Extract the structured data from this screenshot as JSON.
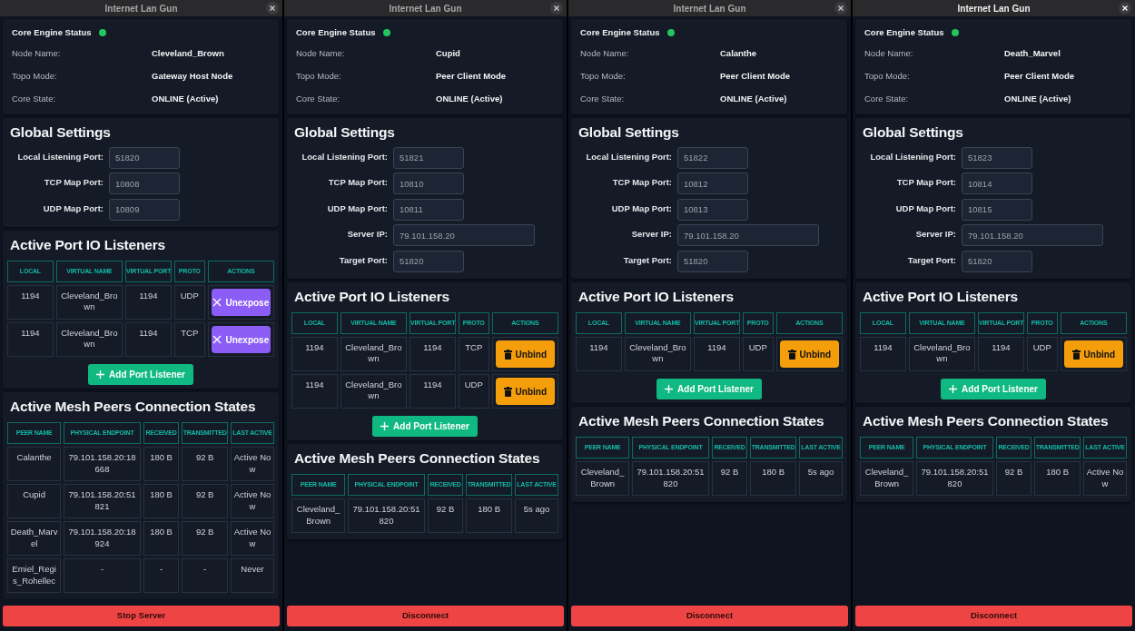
{
  "windows": [
    {
      "title": "Internet Lan Gun",
      "focused": false,
      "status": {
        "title": "Core Engine Status",
        "online": true,
        "rows": [
          {
            "label": "Node Name:",
            "value": "Cleveland_Brown"
          },
          {
            "label": "Topo Mode:",
            "value": "Gateway Host Node"
          },
          {
            "label": "Core State:",
            "value": "ONLINE (Active)"
          }
        ]
      },
      "settings": {
        "title": "Global Settings",
        "fields": [
          {
            "label": "Local Listening Port:",
            "value": "51820",
            "kind": "port"
          },
          {
            "label": "TCP Map Port:",
            "value": "10808",
            "kind": "port"
          },
          {
            "label": "UDP Map Port:",
            "value": "10809",
            "kind": "port"
          }
        ]
      },
      "listeners": {
        "title": "Active Port IO Listeners",
        "columns": [
          "LOCAL",
          "VIRTUAL NAME",
          "VIRTUAL PORT",
          "PROTO",
          "ACTIONS"
        ],
        "rows": [
          {
            "cells": [
              "1194",
              "Cleveland_Brown",
              "1194",
              "UDP"
            ],
            "action": {
              "kind": "unexpose",
              "label": "Unexpose"
            }
          },
          {
            "cells": [
              "1194",
              "Cleveland_Brown",
              "1194",
              "TCP"
            ],
            "action": {
              "kind": "unexpose",
              "label": "Unexpose"
            }
          }
        ],
        "add_button": "Add Port Listener"
      },
      "peers": {
        "title": "Active Mesh Peers Connection States",
        "columns": [
          "PEER NAME",
          "PHYSICAL ENDPOINT",
          "RECEIVED",
          "TRANSMITTED",
          "LAST ACTIVE"
        ],
        "rows": [
          [
            "Calanthe",
            "79.101.158.20:18668",
            "180 B",
            "92 B",
            "Active Now"
          ],
          [
            "Cupid",
            "79.101.158.20:51821",
            "180 B",
            "92 B",
            "Active Now"
          ],
          [
            "Death_Marvel",
            "79.101.158.20:18924",
            "180 B",
            "92 B",
            "Active Now"
          ],
          [
            "Emiel_Regis_Rohellec",
            "-",
            "-",
            "-",
            "Never"
          ]
        ]
      },
      "footer_button": "Stop Server"
    },
    {
      "title": "Internet Lan Gun",
      "focused": false,
      "status": {
        "title": "Core Engine Status",
        "online": true,
        "rows": [
          {
            "label": "Node Name:",
            "value": "Cupid"
          },
          {
            "label": "Topo Mode:",
            "value": "Peer Client Mode"
          },
          {
            "label": "Core State:",
            "value": "ONLINE (Active)"
          }
        ]
      },
      "settings": {
        "title": "Global Settings",
        "fields": [
          {
            "label": "Local Listening Port:",
            "value": "51821",
            "kind": "port"
          },
          {
            "label": "TCP Map Port:",
            "value": "10810",
            "kind": "port"
          },
          {
            "label": "UDP Map Port:",
            "value": "10811",
            "kind": "port"
          },
          {
            "label": "Server IP:",
            "value": "79.101.158.20",
            "kind": "address"
          },
          {
            "label": "Target Port:",
            "value": "51820",
            "kind": "port"
          }
        ]
      },
      "listeners": {
        "title": "Active Port IO Listeners",
        "columns": [
          "LOCAL",
          "VIRTUAL NAME",
          "VIRTUAL PORT",
          "PROTO",
          "ACTIONS"
        ],
        "rows": [
          {
            "cells": [
              "1194",
              "Cleveland_Brown",
              "1194",
              "TCP"
            ],
            "action": {
              "kind": "unbind",
              "label": "Unbind"
            }
          },
          {
            "cells": [
              "1194",
              "Cleveland_Brown",
              "1194",
              "UDP"
            ],
            "action": {
              "kind": "unbind",
              "label": "Unbind"
            }
          }
        ],
        "add_button": "Add Port Listener"
      },
      "peers": {
        "title": "Active Mesh Peers Connection States",
        "columns": [
          "PEER NAME",
          "PHYSICAL ENDPOINT",
          "RECEIVED",
          "TRANSMITTED",
          "LAST ACTIVE"
        ],
        "rows": [
          [
            "Cleveland_Brown",
            "79.101.158.20:51820",
            "92 B",
            "180 B",
            "5s ago"
          ]
        ]
      },
      "footer_button": "Disconnect"
    },
    {
      "title": "Internet Lan Gun",
      "focused": false,
      "status": {
        "title": "Core Engine Status",
        "online": true,
        "rows": [
          {
            "label": "Node Name:",
            "value": "Calanthe"
          },
          {
            "label": "Topo Mode:",
            "value": "Peer Client Mode"
          },
          {
            "label": "Core State:",
            "value": "ONLINE (Active)"
          }
        ]
      },
      "settings": {
        "title": "Global Settings",
        "fields": [
          {
            "label": "Local Listening Port:",
            "value": "51822",
            "kind": "port"
          },
          {
            "label": "TCP Map Port:",
            "value": "10812",
            "kind": "port"
          },
          {
            "label": "UDP Map Port:",
            "value": "10813",
            "kind": "port"
          },
          {
            "label": "Server IP:",
            "value": "79.101.158.20",
            "kind": "address"
          },
          {
            "label": "Target Port:",
            "value": "51820",
            "kind": "port"
          }
        ]
      },
      "listeners": {
        "title": "Active Port IO Listeners",
        "columns": [
          "LOCAL",
          "VIRTUAL NAME",
          "VIRTUAL PORT",
          "PROTO",
          "ACTIONS"
        ],
        "rows": [
          {
            "cells": [
              "1194",
              "Cleveland_Brown",
              "1194",
              "UDP"
            ],
            "action": {
              "kind": "unbind",
              "label": "Unbind"
            }
          }
        ],
        "add_button": "Add Port Listener"
      },
      "peers": {
        "title": "Active Mesh Peers Connection States",
        "columns": [
          "PEER NAME",
          "PHYSICAL ENDPOINT",
          "RECEIVED",
          "TRANSMITTED",
          "LAST ACTIVE"
        ],
        "rows": [
          [
            "Cleveland_Brown",
            "79.101.158.20:51820",
            "92 B",
            "180 B",
            "5s ago"
          ]
        ]
      },
      "footer_button": "Disconnect"
    },
    {
      "title": "Internet Lan Gun",
      "focused": true,
      "status": {
        "title": "Core Engine Status",
        "online": true,
        "rows": [
          {
            "label": "Node Name:",
            "value": "Death_Marvel"
          },
          {
            "label": "Topo Mode:",
            "value": "Peer Client Mode"
          },
          {
            "label": "Core State:",
            "value": "ONLINE (Active)"
          }
        ]
      },
      "settings": {
        "title": "Global Settings",
        "fields": [
          {
            "label": "Local Listening Port:",
            "value": "51823",
            "kind": "port"
          },
          {
            "label": "TCP Map Port:",
            "value": "10814",
            "kind": "port"
          },
          {
            "label": "UDP Map Port:",
            "value": "10815",
            "kind": "port"
          },
          {
            "label": "Server IP:",
            "value": "79.101.158.20",
            "kind": "address"
          },
          {
            "label": "Target Port:",
            "value": "51820",
            "kind": "port"
          }
        ]
      },
      "listeners": {
        "title": "Active Port IO Listeners",
        "columns": [
          "LOCAL",
          "VIRTUAL NAME",
          "VIRTUAL PORT",
          "PROTO",
          "ACTIONS"
        ],
        "rows": [
          {
            "cells": [
              "1194",
              "Cleveland_Brown",
              "1194",
              "UDP"
            ],
            "action": {
              "kind": "unbind",
              "label": "Unbind"
            }
          }
        ],
        "add_button": "Add Port Listener"
      },
      "peers": {
        "title": "Active Mesh Peers Connection States",
        "columns": [
          "PEER NAME",
          "PHYSICAL ENDPOINT",
          "RECEIVED",
          "TRANSMITTED",
          "LAST ACTIVE"
        ],
        "rows": [
          [
            "Cleveland_Brown",
            "79.101.158.20:51820",
            "92 B",
            "180 B",
            "Active Now"
          ]
        ]
      },
      "footer_button": "Disconnect"
    }
  ]
}
